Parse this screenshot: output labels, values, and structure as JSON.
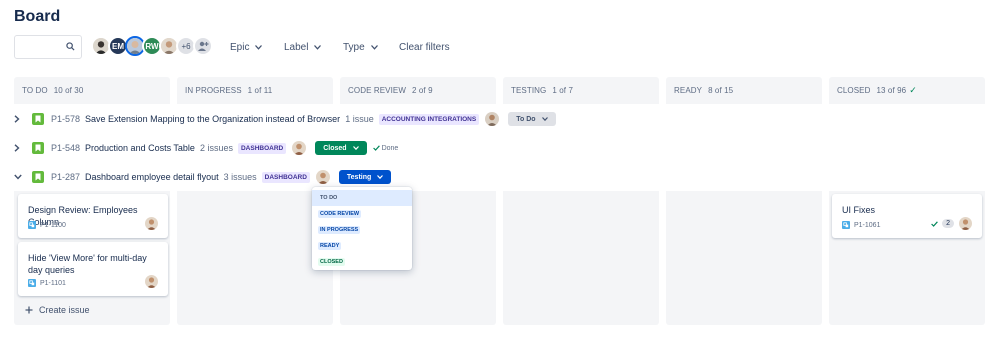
{
  "page": {
    "title": "Board"
  },
  "filters": {
    "search_placeholder": "",
    "avatars": [
      {
        "name": "user-photo-1",
        "initials": ""
      },
      {
        "name": "em",
        "initials": "EM"
      },
      {
        "name": "user-photo-selected",
        "initials": ""
      },
      {
        "name": "rw",
        "initials": "RW"
      },
      {
        "name": "user-photo-2",
        "initials": ""
      },
      {
        "name": "more",
        "initials": "+6"
      }
    ],
    "epic_label": "Epic",
    "label_label": "Label",
    "type_label": "Type",
    "clear_label": "Clear filters"
  },
  "columns": [
    {
      "name": "TO DO",
      "count": "10 of 30"
    },
    {
      "name": "IN PROGRESS",
      "count": "1 of 11"
    },
    {
      "name": "CODE REVIEW",
      "count": "2 of 9"
    },
    {
      "name": "TESTING",
      "count": "1 of 7"
    },
    {
      "name": "READY",
      "count": "8 of 15"
    },
    {
      "name": "CLOSED",
      "count": "13 of 96",
      "check": "✓"
    }
  ],
  "epics": [
    {
      "key": "P1-578",
      "title": "Save Extension Mapping to the Organization instead of Browser",
      "count": "1 issue",
      "label": "ACCOUNTING INTEGRATIONS",
      "status": "To Do",
      "done": ""
    },
    {
      "key": "P1-548",
      "title": "Production and Costs Table",
      "count": "2 issues",
      "label": "DASHBOARD",
      "status": "Closed",
      "done": "Done"
    },
    {
      "key": "P1-287",
      "title": "Dashboard employee detail flyout",
      "count": "3 issues",
      "label": "DASHBOARD",
      "status": "Testing",
      "done": ""
    }
  ],
  "dropdown": {
    "options": [
      "TO DO",
      "CODE REVIEW",
      "IN PROGRESS",
      "READY",
      "CLOSED"
    ]
  },
  "cards": [
    {
      "title": "Design Review: Employees Column",
      "key": "P1-1100"
    },
    {
      "title": "Hide 'View More' for multi-day day queries",
      "key": "P1-1101"
    },
    {
      "title": "UI Fixes",
      "key": "P1-1061",
      "subtasks": "2"
    }
  ],
  "create_issue_label": "Create issue",
  "colors": {
    "column_bg": "#f4f5f7",
    "story_green": "#63ba3c",
    "status_closed": "#00875a",
    "status_testing": "#0052cc",
    "text_primary": "#172b4d",
    "text_secondary": "#5e6c84"
  }
}
